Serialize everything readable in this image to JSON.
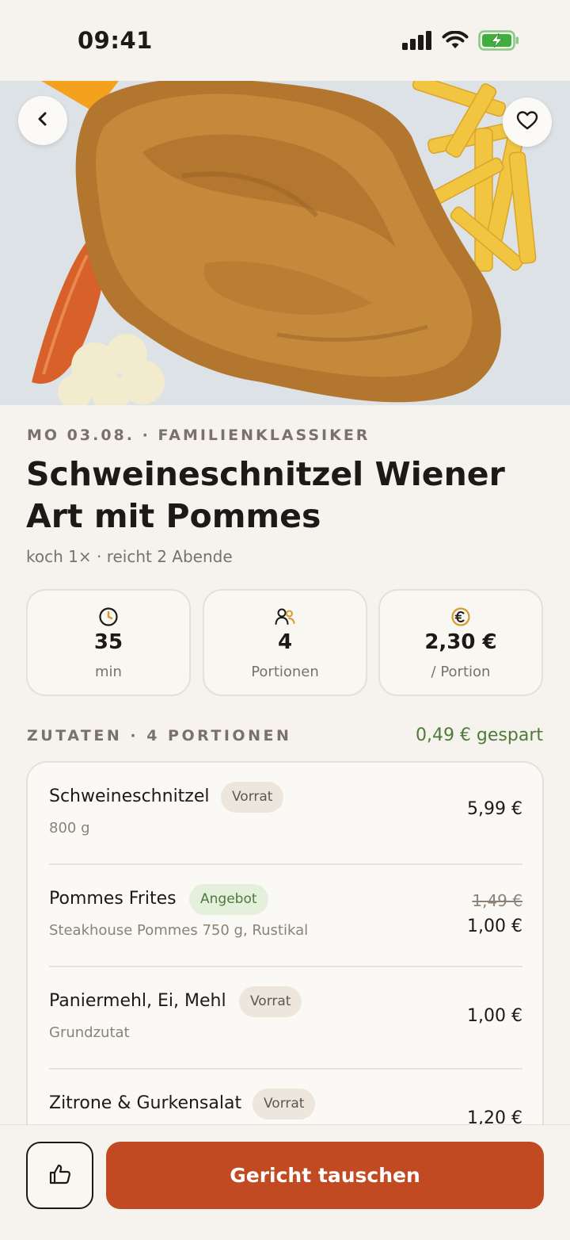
{
  "status_bar": {
    "time": "09:41",
    "icons": [
      "cellular-signal-icon",
      "wifi-icon",
      "battery-charging-icon"
    ]
  },
  "hero": {
    "image": "schweineschnitzel-mit-pommes-photo",
    "back_icon": "chevron-left-icon",
    "favorite_icon": "heart-icon"
  },
  "recipe": {
    "meta": "MO 03.08. · FAMILIENKLASSIKER",
    "title": "Schweineschnitzel Wiener Art mit Pommes",
    "subtitle": "koch 1× · reicht 2 Abende"
  },
  "stats": [
    {
      "icon": "clock-icon",
      "value": "35",
      "label": "min"
    },
    {
      "icon": "people-icon",
      "value": "4",
      "label": "Portionen"
    },
    {
      "icon": "euro-icon",
      "value": "2,30 €",
      "label": "/ Portion"
    }
  ],
  "ingredients_section": {
    "label": "ZUTATEN · 4 PORTIONEN",
    "saved": "0,49 € gespart"
  },
  "ingredients": [
    {
      "name": "Schweineschnitzel",
      "badge": "Vorrat",
      "detail": "800 g",
      "price": "5,99 €"
    },
    {
      "name": "Pommes Frites",
      "badge": "Angebot",
      "detail": "Steakhouse Pommes 750 g, Rustikal",
      "old_price": "1,49 €",
      "price": "1,00 €"
    },
    {
      "name": "Paniermehl, Ei, Mehl",
      "badge": "Vorrat",
      "detail": "Grundzutat",
      "price": "1,00 €"
    },
    {
      "name": "Zitrone & Gurkensalat",
      "badge": "Vorrat",
      "detail": "",
      "price": "1,20 €"
    }
  ],
  "actions": {
    "like_icon": "thumbs-up-icon",
    "swap_label": "Gericht tauschen"
  },
  "colors": {
    "accent": "#c14a22",
    "saved_green": "#4f7a3a",
    "background": "#f6f3ee"
  }
}
